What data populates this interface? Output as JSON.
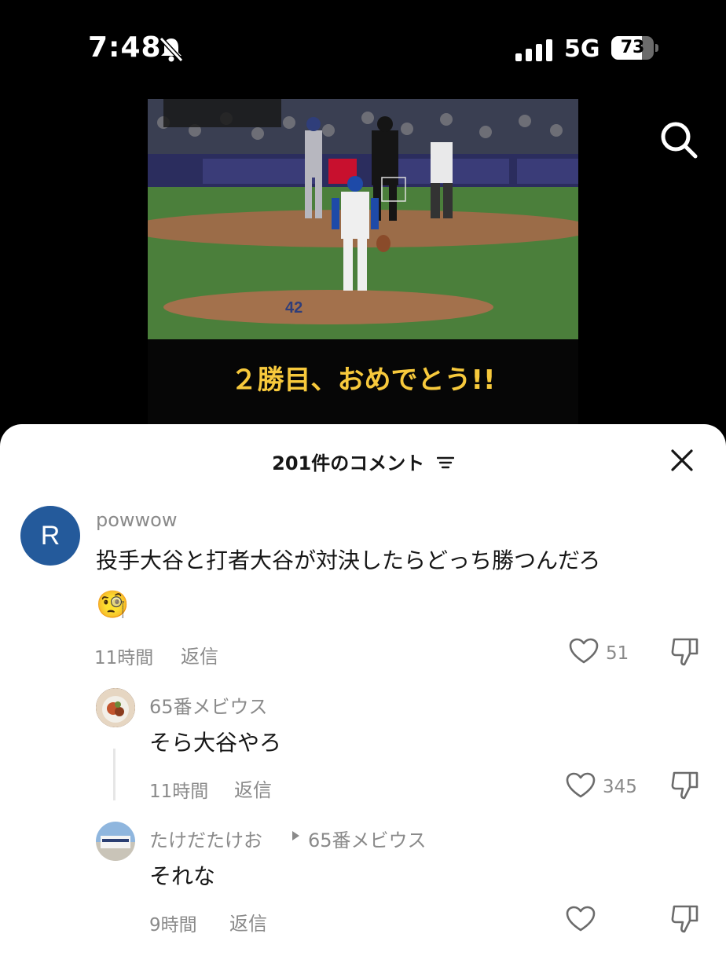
{
  "status_bar": {
    "time": "7:48",
    "network": "5G",
    "battery_percent": 73,
    "battery_label": "73",
    "icons": [
      "bell-muted-icon",
      "signal-icon",
      "battery-icon"
    ]
  },
  "video": {
    "caption": "２勝目、おめでとう!!"
  },
  "header": {
    "title": "201件のコメント",
    "icons": [
      "filter-icon",
      "close-icon",
      "search-icon"
    ]
  },
  "comments": [
    {
      "username": "powwow",
      "avatar_letter": "R",
      "text": "投手大谷と打者大谷が対決したらどっち勝つんだろ",
      "emoji": "🧐",
      "time": "11時間",
      "reply_label": "返信",
      "likes": "51"
    },
    {
      "username": "65番メビウス",
      "text": "そら大谷やろ",
      "time": "11時間",
      "reply_label": "返信",
      "likes": "345"
    },
    {
      "username": "たけだたけお",
      "reply_to": "65番メビウス",
      "text": "それな",
      "time": "9時間",
      "reply_label": "返信",
      "likes": ""
    }
  ],
  "colors": {
    "caption": "#f7c93c",
    "avatar_r": "#245a9b",
    "meta_gray": "#8a8a8a"
  }
}
